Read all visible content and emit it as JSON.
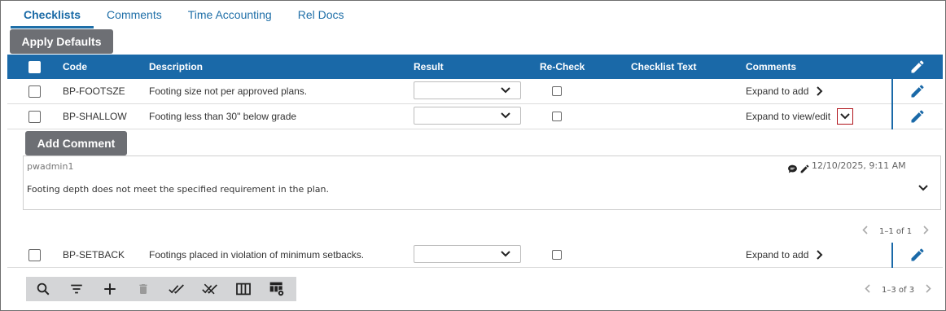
{
  "tabs": [
    {
      "label": "Checklists",
      "active": true
    },
    {
      "label": "Comments",
      "active": false
    },
    {
      "label": "Time Accounting",
      "active": false
    },
    {
      "label": "Rel Docs",
      "active": false
    }
  ],
  "apply_defaults_label": "Apply Defaults",
  "table": {
    "headers": {
      "code": "Code",
      "description": "Description",
      "result": "Result",
      "recheck": "Re-Check",
      "checklist_text": "Checklist Text",
      "comments": "Comments"
    },
    "rows": [
      {
        "code": "BP-FOOTSZE",
        "description": "Footing size not per approved plans.",
        "result": "",
        "comments": "Expand to add"
      },
      {
        "code": "BP-SHALLOW",
        "description": "Footing less than 30\" below grade",
        "result": "",
        "comments": "Expand to view/edit"
      },
      {
        "code": "BP-SETBACK",
        "description": "Footings placed in violation of minimum setbacks.",
        "result": "",
        "comments": "Expand to add"
      }
    ]
  },
  "comment_section": {
    "add_comment_label": "Add Comment",
    "comment": {
      "user": "pwadmin1",
      "date": "12/10/2025, 9:11 AM",
      "text": "Footing depth does not meet the specified requirement in the plan."
    },
    "pager": "1–1 of 1"
  },
  "bottom_pager": "1–3 of 3",
  "toolbar_icons": [
    "search-icon",
    "filter-icon",
    "add-icon",
    "delete-icon",
    "check-all-icon",
    "uncheck-all-icon",
    "columns-icon",
    "table-settings-icon"
  ],
  "colors": {
    "header_blue": "#1a69a8",
    "tab_blue": "#1f6fa8",
    "button_gray": "#6d6f74",
    "highlight_red": "#b0141b"
  }
}
